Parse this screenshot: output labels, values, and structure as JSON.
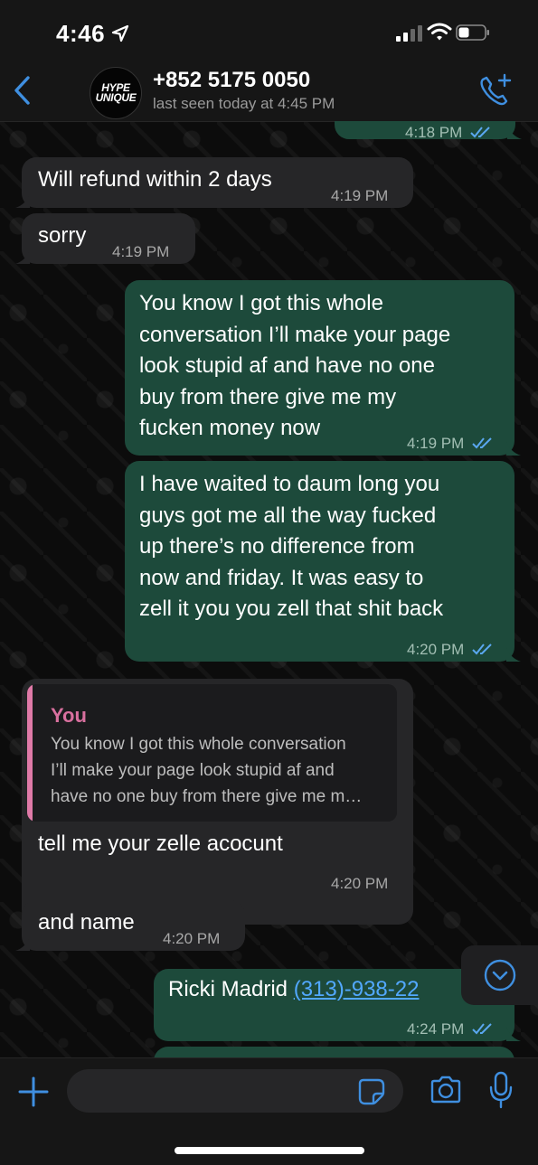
{
  "status_bar": {
    "time": "4:46"
  },
  "header": {
    "avatar_text_1": "HYPE",
    "avatar_text_2": "UNIQUE",
    "contact_name": "+852 5175 0050",
    "last_seen": "last seen today at 4:45 PM"
  },
  "messages": [
    {
      "from": "me",
      "partial_time": "4:18 PM"
    },
    {
      "from": "them",
      "text": "Will refund within 2 days",
      "time": "4:19 PM"
    },
    {
      "from": "them",
      "text": "sorry",
      "time": "4:19 PM"
    },
    {
      "from": "me",
      "lines": [
        "You know I got this whole",
        "conversation I’ll make your page",
        "look stupid af and have no one",
        "buy from there give me my",
        "fucken money now"
      ],
      "time": "4:19 PM",
      "read": true
    },
    {
      "from": "me",
      "lines": [
        "I have waited to daum long you",
        "guys got me all the way fucked",
        "up there’s no difference from",
        "now and friday. It was easy to",
        "zell it you you zell that shit back"
      ],
      "time": "4:20 PM",
      "read": true
    },
    {
      "from": "them",
      "quote_author": "You",
      "quote_lines": [
        "You know I got this whole conversation",
        "I’ll make your page look stupid af and",
        "have no one buy from there give me m…"
      ],
      "text": "tell me your zelle acocunt",
      "time": "4:20 PM"
    },
    {
      "from": "them",
      "text": "and name",
      "time": "4:20 PM"
    },
    {
      "from": "me",
      "text": "Ricki Madrid ",
      "link": "(313)-938-22",
      "time": "4:24 PM",
      "read": true
    }
  ],
  "input": {
    "placeholder": ""
  },
  "colors": {
    "incoming_bubble": "#262628",
    "outgoing_bubble": "#1d4a3b",
    "accent": "#3f8fe0",
    "quote_accent": "#e07aa8",
    "read_ticks": "#5aa7f0"
  },
  "icons": [
    "location-arrow-icon",
    "signal-icon",
    "wifi-icon",
    "battery-icon",
    "back-chevron-icon",
    "add-call-icon",
    "scroll-down-icon",
    "plus-icon",
    "sticker-icon",
    "camera-icon",
    "microphone-icon"
  ]
}
